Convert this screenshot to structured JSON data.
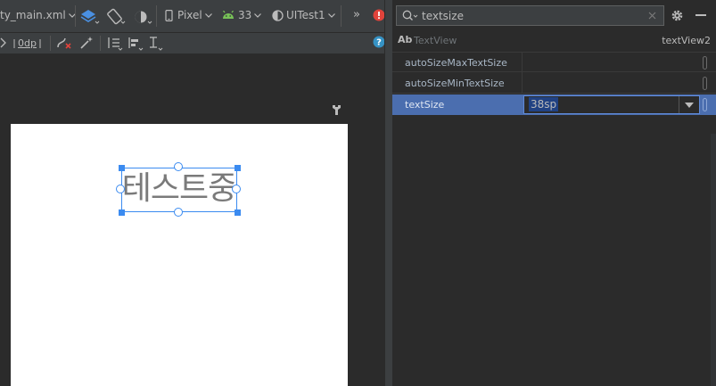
{
  "toolbar": {
    "file_name": "ty_main.xml",
    "device_label": "Pixel",
    "api_level": "33",
    "theme_label": "UITest1",
    "overflow_label": "»",
    "default_margin": "0dp"
  },
  "search": {
    "value": "textsize",
    "placeholder": ""
  },
  "component": {
    "badge": "Ab",
    "type": "TextView",
    "id": "textView2"
  },
  "attributes": [
    {
      "name": "autoSizeMaxTextSize",
      "value": ""
    },
    {
      "name": "autoSizeMinTextSize",
      "value": ""
    },
    {
      "name": "textSize",
      "value": "38sp",
      "selected": true
    }
  ],
  "preview": {
    "text": "테스트중"
  },
  "colors": {
    "selection_blue": "#3b8bf0",
    "selected_row": "#4b6eaf",
    "panel_bg": "#2b2b2b",
    "toolbar_bg": "#3c3f41",
    "error_red": "#e0433b",
    "android_green": "#78c257"
  }
}
